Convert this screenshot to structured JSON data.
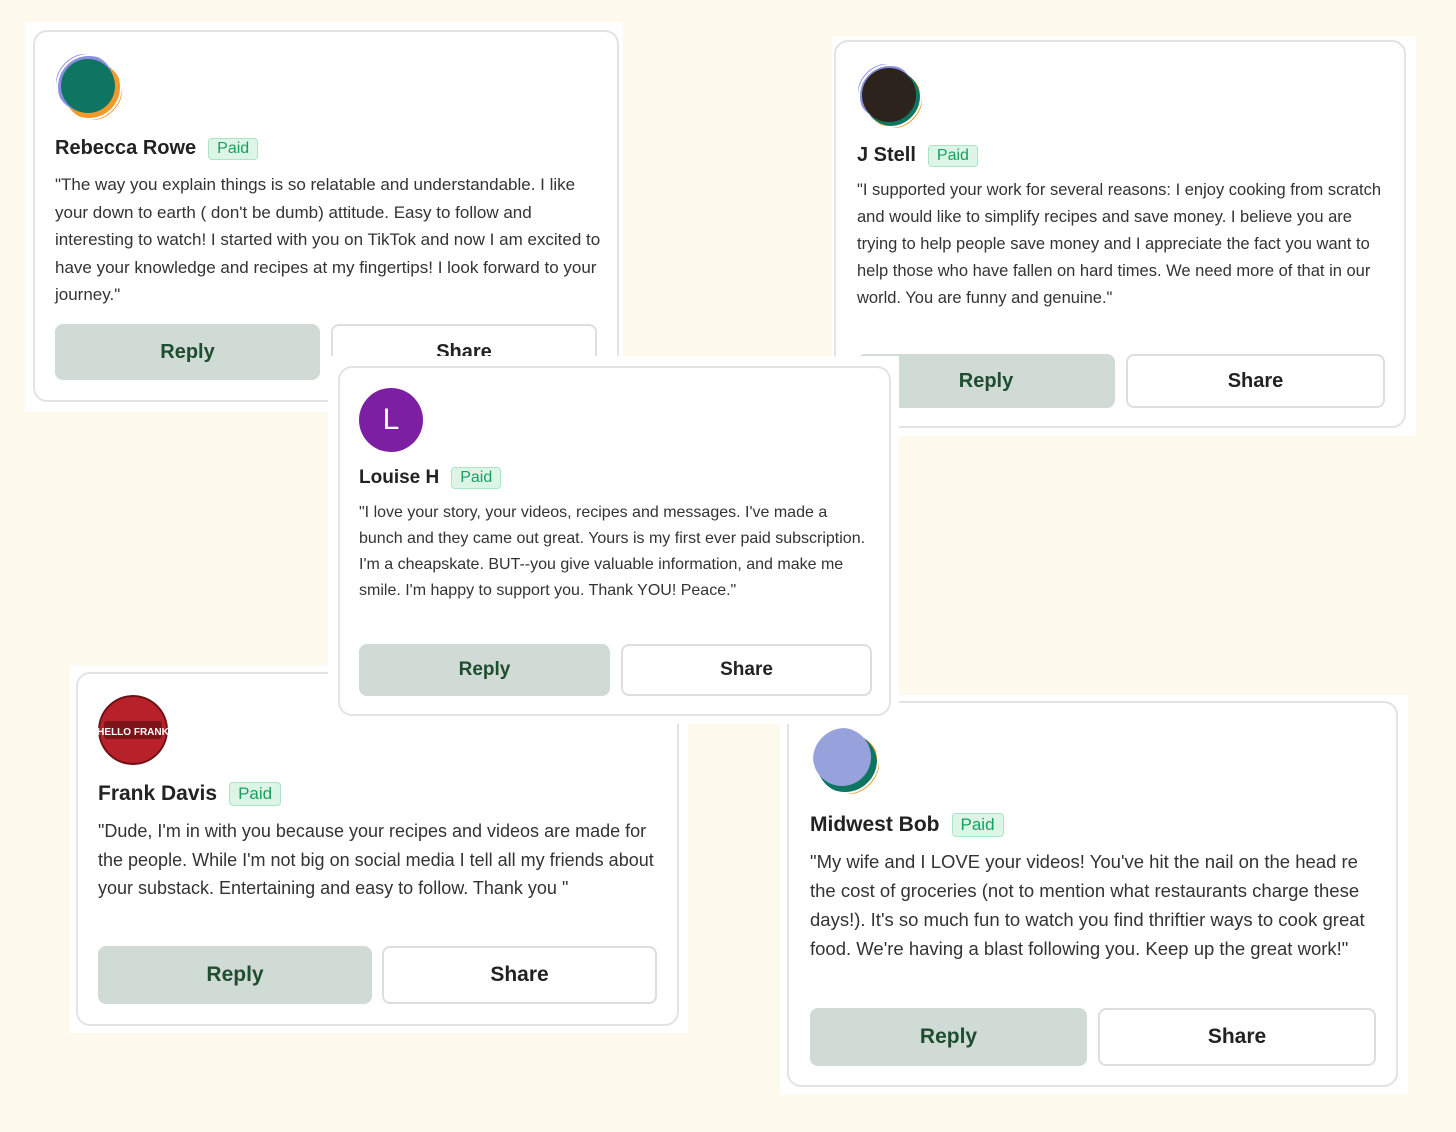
{
  "comments": [
    {
      "name": "Rebecca Rowe",
      "badge": "Paid",
      "quote": "\"The way you explain things is so relatable and understandable. I like your down to earth ( don't be dumb) attitude. Easy to follow and interesting to watch! I started with you on TikTok and now I am excited to have your knowledge and recipes at my fingertips! I look forward to your journey.\"",
      "reply": "Reply",
      "share": "Share",
      "avatar_colors": [
        "#0e7560",
        "#f39a2b",
        "#8a8fe0"
      ]
    },
    {
      "name": "J Stell",
      "badge": "Paid",
      "quote": "\"I supported your work for several reasons: I enjoy cooking from scratch and would like to simplify recipes and save money. I believe you are trying to help people save money and I appreciate the fact you want to help those who have fallen on hard times. We need more of that in our world. You are funny and genuine.\"",
      "reply": "Reply",
      "share": "Share",
      "avatar_colors": [
        "#2d231d",
        "#f39a2b",
        "#8a8fe0"
      ]
    },
    {
      "name": "Louise H",
      "badge": "Paid",
      "quote": "\"I love your story, your videos, recipes and messages. I've made a bunch and they came out great. Yours is my first ever paid subscription. I'm a cheapskate. BUT--you give valuable information, and make me smile. I'm happy to support you. Thank YOU! Peace.\"",
      "reply": "Reply",
      "share": "Share",
      "avatar_letter": "L",
      "avatar_color": "#7c1fa3"
    },
    {
      "name": "Frank Davis",
      "badge": "Paid",
      "quote": "\"Dude, I'm in with you because your recipes and videos are made for the people. While I'm not big on social media I tell all my friends about your substack. Entertaining and easy to follow. Thank you \"",
      "reply": "Reply",
      "share": "Share",
      "avatar_text": "HELLO FRANK",
      "avatar_color": "#b8202a"
    },
    {
      "name": "Midwest Bob",
      "badge": "Paid",
      "quote": "\"My wife and I LOVE your videos! You've hit the nail on the head re the cost of groceries (not to mention what restaurants charge these days!). It's so much fun to watch you find thriftier ways to cook great food. We're having a blast following you. Keep up the great work!\"",
      "reply": "Reply",
      "share": "Share",
      "avatar_colors": [
        "#97a2dc",
        "#f39a2b",
        "#0e7560"
      ]
    }
  ]
}
